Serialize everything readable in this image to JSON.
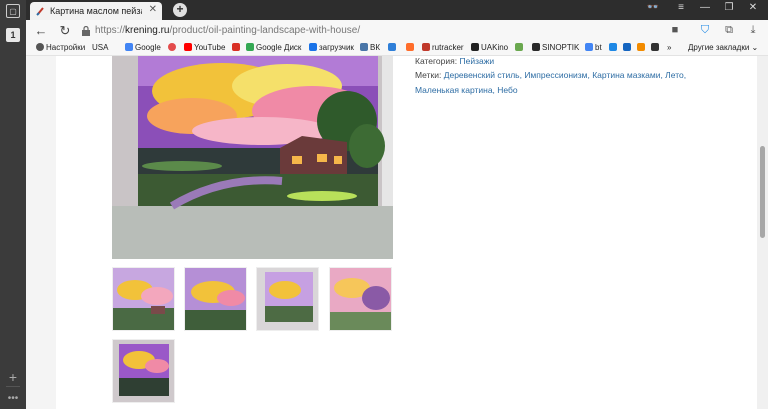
{
  "browser": {
    "tab_title": "Картина маслом пейзаж",
    "url_prefix": "https://",
    "url_domain": "krening.ru",
    "url_path": "/product/oil-painting-landscape-with-house/"
  },
  "bookmarks": [
    {
      "label": "Настройки",
      "color": "#555555"
    },
    {
      "label": "USA",
      "color": ""
    },
    {
      "label": "Google",
      "color": "#4285f4"
    },
    {
      "label": "",
      "color": "#e34b4b"
    },
    {
      "label": "YouTube",
      "color": "#ff0000"
    },
    {
      "label": "",
      "color": "#d93025"
    },
    {
      "label": "Google Диск",
      "color": "#34a853"
    },
    {
      "label": "загрузчик",
      "color": "#1a73e8"
    },
    {
      "label": "ВК",
      "color": "#4a76a8"
    },
    {
      "label": "",
      "color": "#2f7fd8"
    },
    {
      "label": "",
      "color": "#ff6d2b"
    },
    {
      "label": "rutracker",
      "color": "#c0392b"
    },
    {
      "label": "UAKino",
      "color": "#222222"
    },
    {
      "label": "",
      "color": "#6aa84f"
    },
    {
      "label": "SINOPTIK",
      "color": "#2a2a2a"
    },
    {
      "label": "bt",
      "color": "#4285f4"
    },
    {
      "label": "",
      "color": "#1e88e5"
    },
    {
      "label": "",
      "color": "#1565c0"
    },
    {
      "label": "",
      "color": "#f28b00"
    },
    {
      "label": "",
      "color": "#333333"
    },
    {
      "label": "»",
      "color": ""
    }
  ],
  "other_bookmarks": "Другие закладки",
  "product": {
    "category_label": "Категория:",
    "category": "Пейзажи",
    "tags_label": "Метки:",
    "tags_line1": "Деревенский стиль, Импрессионизм, Картина мазками, Лето,",
    "tags_line2": "Маленькая картина, Небо"
  }
}
